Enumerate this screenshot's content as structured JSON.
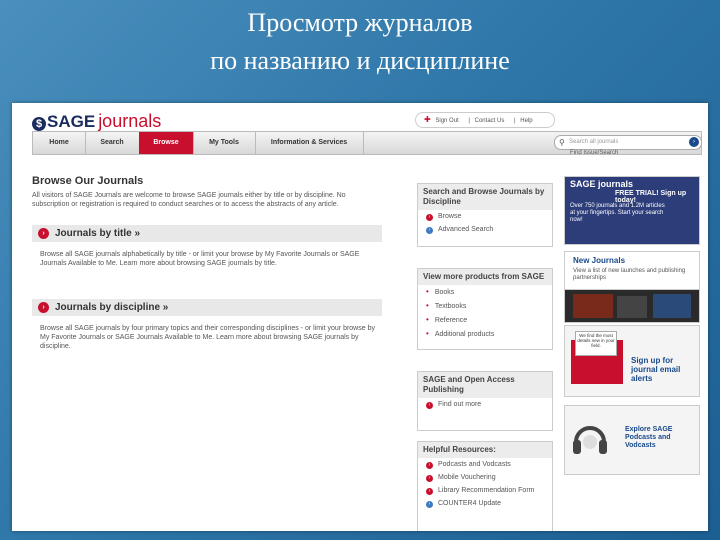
{
  "slide": {
    "title_line1": "Просмотр журналов",
    "title_line2": "по названию и дисциплине"
  },
  "header": {
    "logo_sage": "SAGE",
    "logo_journals": "journals",
    "links": [
      "Sign Out",
      "Contact Us",
      "Help"
    ],
    "search_placeholder": "Search all journals",
    "find_issue": "Find Issue/Search"
  },
  "nav": {
    "items": [
      "Home",
      "Search",
      "Browse",
      "My Tools",
      "Information & Services"
    ],
    "active": "Browse"
  },
  "main": {
    "title": "Browse Our Journals",
    "intro": "All visitors of SAGE Journals are welcome to browse SAGE journals either by title or by discipline. No subscription or registration is required to conduct searches or to access the abstracts of any article.",
    "sections": [
      {
        "heading": "Journals by title »",
        "text": "Browse all SAGE journals alphabetically by title - or limit your browse by My Favorite Journals or SAGE Journals Available to Me. Learn more about browsing SAGE journals by title."
      },
      {
        "heading": "Journals by discipline »",
        "text": "Browse all SAGE journals by four primary topics and their corresponding disciplines - or limit your browse by My Favorite Journals or SAGE Journals Available to Me. Learn more about browsing SAGE journals by discipline."
      }
    ]
  },
  "sidebar": {
    "box1": {
      "heading": "Search and Browse Journals by Discipline",
      "items": [
        "Browse",
        "Advanced Search"
      ]
    },
    "box2": {
      "heading": "View more products from SAGE",
      "items": [
        "Books",
        "Textbooks",
        "Reference",
        "Additional products"
      ]
    },
    "box3": {
      "heading": "SAGE and Open Access Publishing",
      "items": [
        "Find out more"
      ]
    },
    "box4": {
      "heading": "Helpful Resources:",
      "items": [
        "Podcasts and Vodcasts",
        "Mobile Vouchering",
        "Library Recommendation Form",
        "COUNTER4 Update"
      ]
    }
  },
  "ads": {
    "trial": {
      "brand": "SAGE journals",
      "headline": "FREE TRIAL! Sign up today!",
      "text": "Over 750 journals and 1.2M articles at your fingertips. Start your search now!"
    },
    "new_journals": {
      "title": "New Journals",
      "text": "View a list of new launches and publishing partnerships"
    },
    "alerts": {
      "note": "We find the most details new in your field.",
      "text": "Sign up for journal email alerts"
    },
    "podcasts": {
      "text": "Explore SAGE Podcasts and Vodcasts"
    }
  },
  "colors": {
    "brand_red": "#c8102e",
    "brand_navy": "#1a2c5e",
    "slide_bg": "#2f77a9"
  }
}
